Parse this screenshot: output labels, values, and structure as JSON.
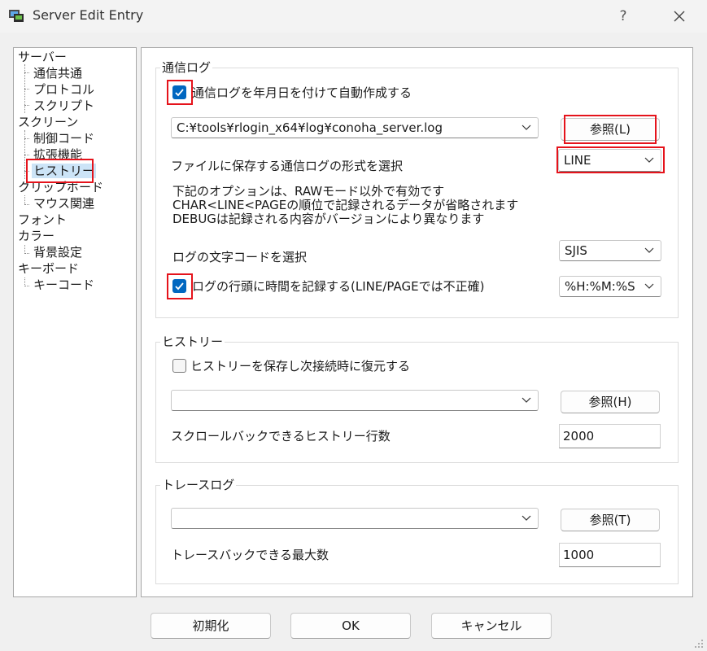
{
  "window": {
    "title": "Server Edit Entry",
    "help": "?",
    "close": "close"
  },
  "tree": {
    "items": [
      {
        "label": "サーバー",
        "level": 0
      },
      {
        "label": "通信共通",
        "level": 1
      },
      {
        "label": "プロトコル",
        "level": 1
      },
      {
        "label": "スクリプト",
        "level": 1
      },
      {
        "label": "スクリーン",
        "level": 0
      },
      {
        "label": "制御コード",
        "level": 1
      },
      {
        "label": "拡張機能",
        "level": 1
      },
      {
        "label": "ヒストリー",
        "level": 1,
        "selected": true
      },
      {
        "label": "クリップボード",
        "level": 0
      },
      {
        "label": "マウス関連",
        "level": 1
      },
      {
        "label": "フォント",
        "level": 0
      },
      {
        "label": "カラー",
        "level": 0
      },
      {
        "label": "背景設定",
        "level": 1
      },
      {
        "label": "キーボード",
        "level": 0
      },
      {
        "label": "キーコード",
        "level": 1
      }
    ]
  },
  "log_group": {
    "title": "通信ログ",
    "auto_create_label": "通信ログを年月日を付けて自動作成する",
    "auto_create_checked": true,
    "log_path": "C:¥tools¥rlogin_x64¥log¥conoha_server.log",
    "browse_label": "参照(L)",
    "format_label": "ファイルに保存する通信ログの形式を選択",
    "format_value": "LINE",
    "desc_line1": "下記のオプションは、RAWモード以外で有効です",
    "desc_line2": "CHAR<LINE<PAGEの順位で記録されるデータが省略されます",
    "desc_line3": "DEBUGは記録される内容がバージョンにより異なります",
    "charset_label": "ログの文字コードを選択",
    "charset_value": "SJIS",
    "timestamp_label": "ログの行頭に時間を記録する(LINE/PAGEでは不正確)",
    "timestamp_checked": true,
    "timestamp_format": "%H:%M:%S"
  },
  "history_group": {
    "title": "ヒストリー",
    "save_label": "ヒストリーを保存し次接続時に復元する",
    "save_checked": false,
    "path": "",
    "browse_label": "参照(H)",
    "scrollback_label": "スクロールバックできるヒストリー行数",
    "scrollback_value": "2000"
  },
  "trace_group": {
    "title": "トレースログ",
    "path": "",
    "browse_label": "参照(T)",
    "traceback_label": "トレースバックできる最大数",
    "traceback_value": "1000"
  },
  "footer": {
    "reset_label": "初期化",
    "ok_label": "OK",
    "cancel_label": "キャンセル"
  },
  "colors": {
    "highlight": "#e5131b",
    "check": "#0067c0",
    "selection": "#cce4f7"
  }
}
